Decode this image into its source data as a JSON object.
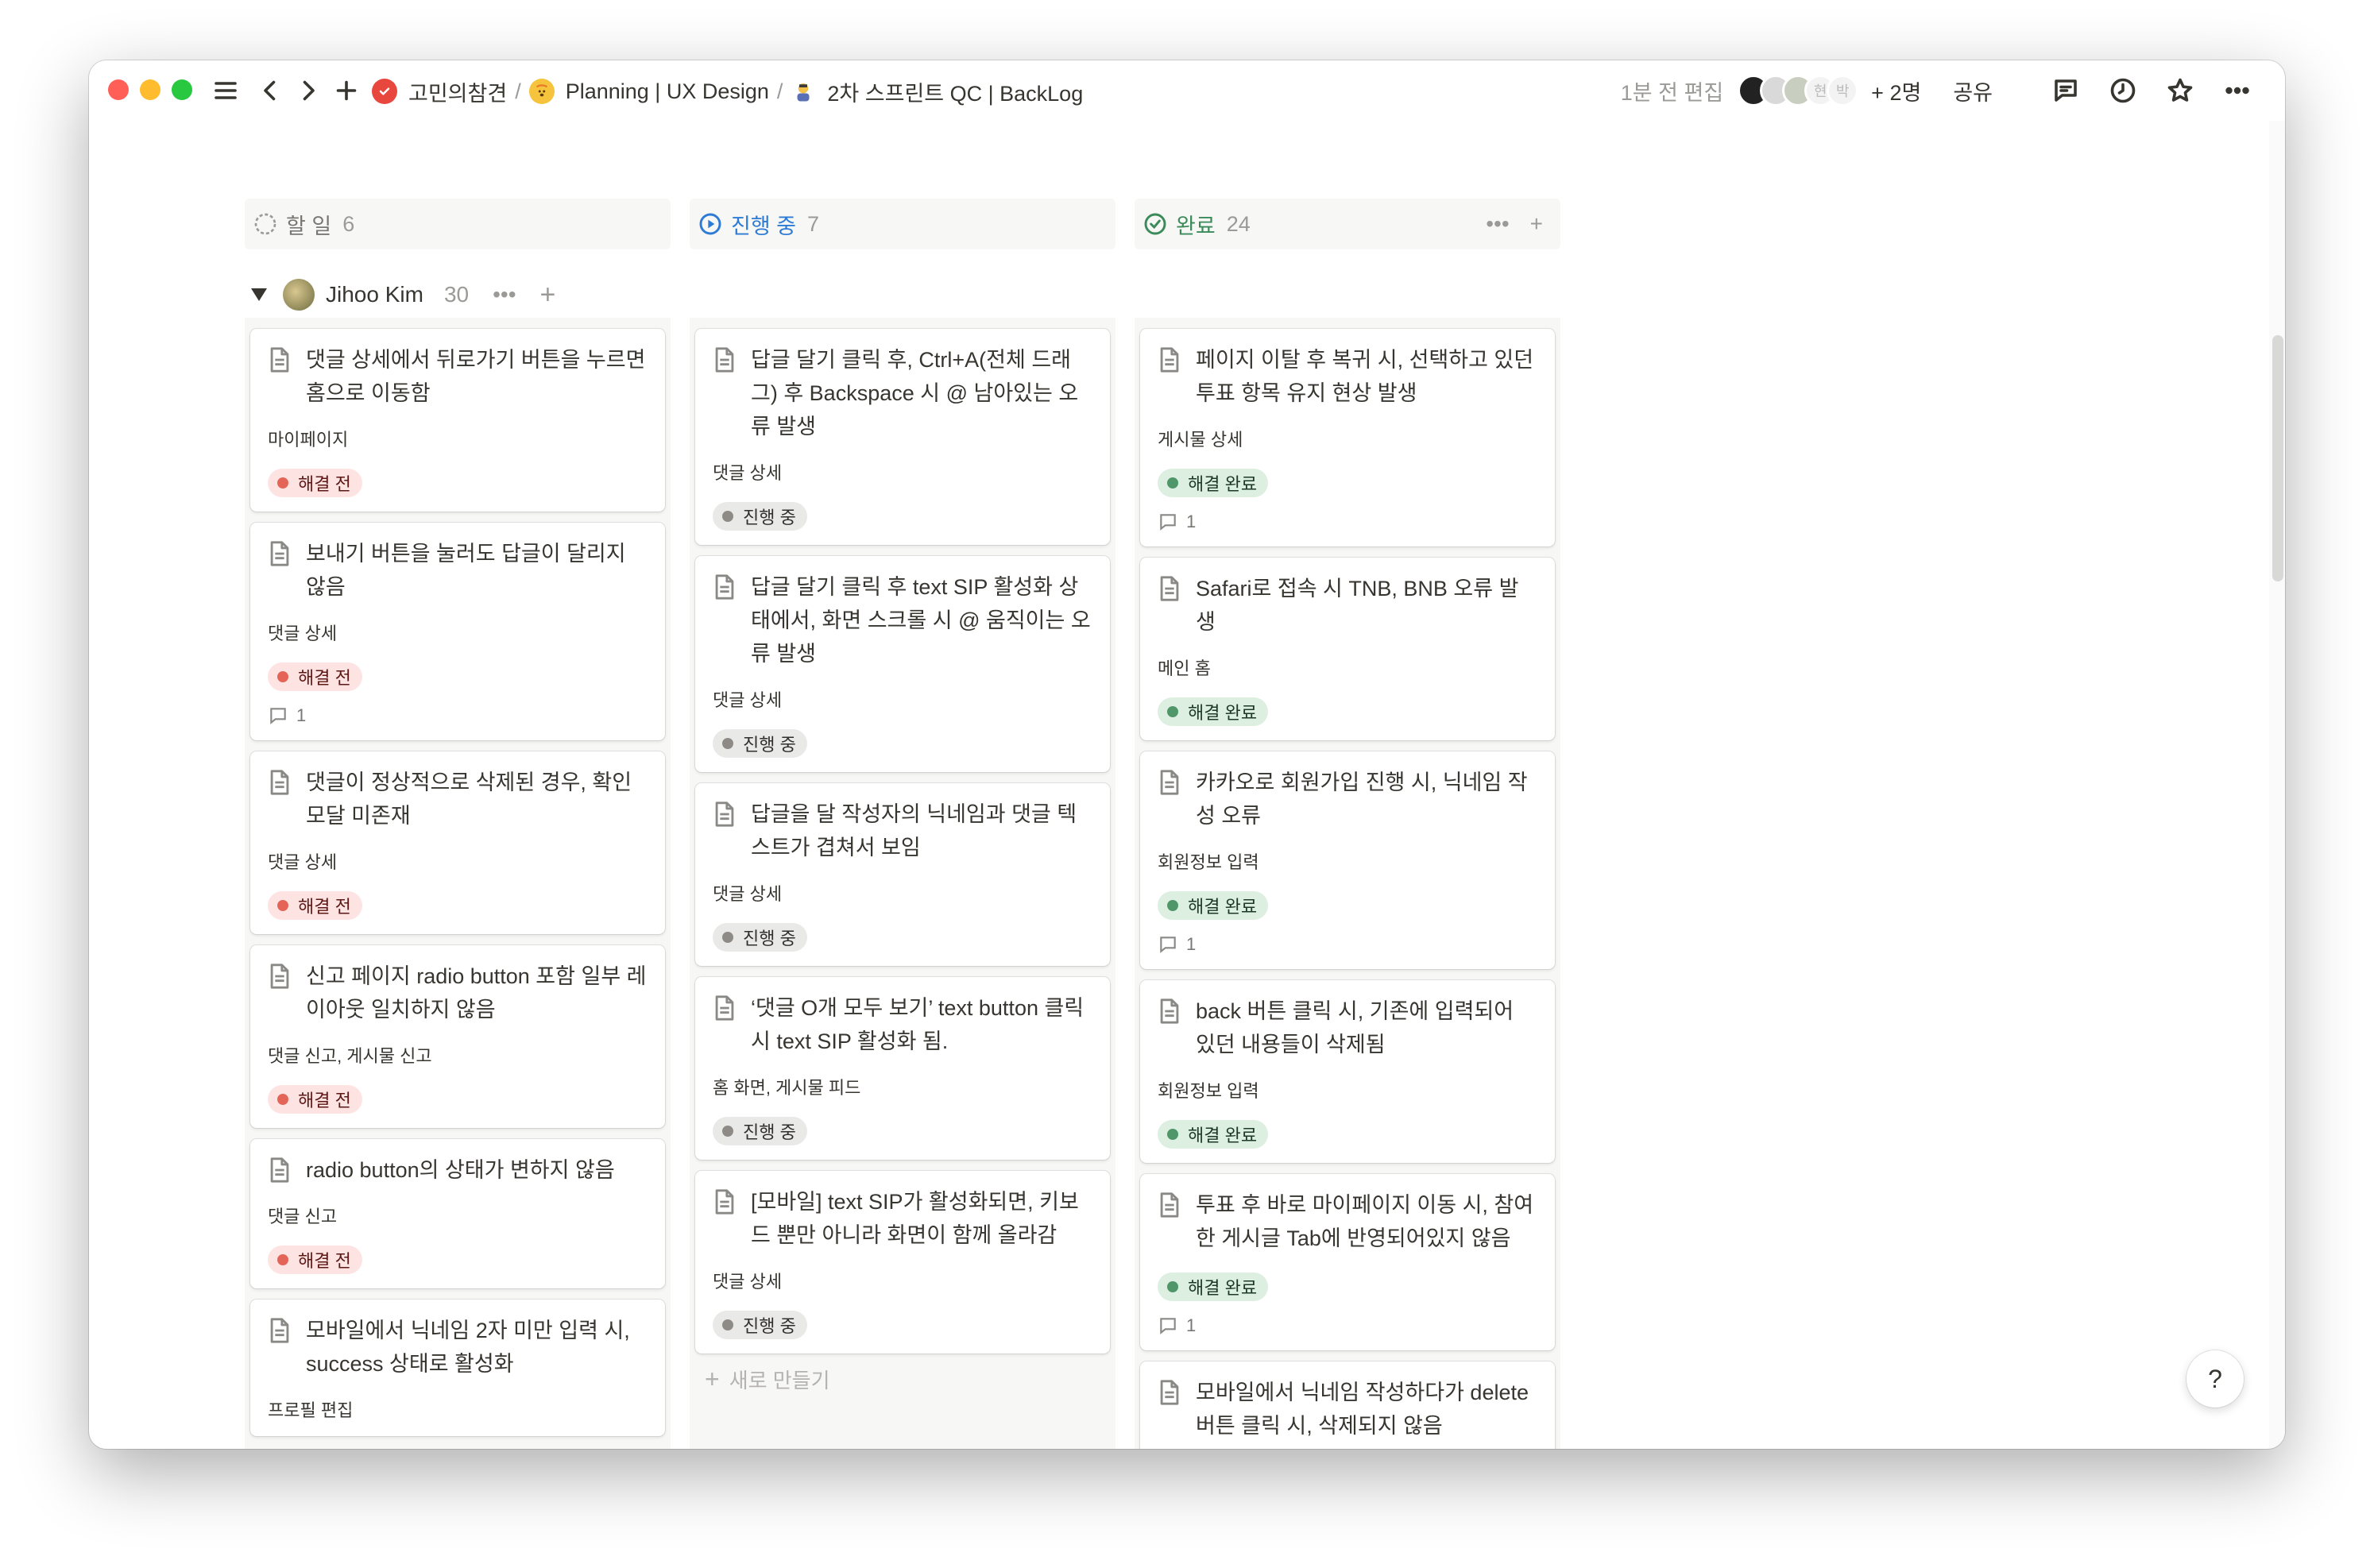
{
  "breadcrumb": [
    {
      "label": "고민의참견"
    },
    {
      "label": "Planning | UX Design"
    },
    {
      "label": "2차 스프린트 QC | BackLog"
    }
  ],
  "topbar": {
    "edited": "1분 전 편집",
    "avatar_initials": [
      "현",
      "박"
    ],
    "more_people": "+ 2명",
    "share": "공유"
  },
  "columns": [
    {
      "key": "todo",
      "label": "할 일",
      "count": "6"
    },
    {
      "key": "progress",
      "label": "진행 중",
      "count": "7"
    },
    {
      "key": "done",
      "label": "완료",
      "count": "24"
    }
  ],
  "group": {
    "name": "Jihoo Kim",
    "count": "30"
  },
  "cards_todo": [
    {
      "title": "댓글 상세에서 뒤로가기 버튼을 누르면 홈으로 이동함",
      "tag": "마이페이지",
      "status": "해결 전",
      "comments": ""
    },
    {
      "title": "보내기 버튼을 눌러도 답글이 달리지 않음",
      "tag": "댓글 상세",
      "status": "해결 전",
      "comments": "1"
    },
    {
      "title": "댓글이 정상적으로 삭제된 경우, 확인 모달 미존재",
      "tag": "댓글 상세",
      "status": "해결 전",
      "comments": ""
    },
    {
      "title": "신고 페이지 radio button 포함 일부 레이아웃 일치하지 않음",
      "tag": "댓글 신고, 게시물 신고",
      "status": "해결 전",
      "comments": ""
    },
    {
      "title": "radio button의 상태가 변하지 않음",
      "tag": "댓글 신고",
      "status": "해결 전",
      "comments": ""
    },
    {
      "title": "모바일에서 닉네임 2자 미만 입력 시, success 상태로 활성화",
      "tag": "프로필 편집",
      "status": "",
      "comments": ""
    }
  ],
  "cards_progress": [
    {
      "title": "답글 달기 클릭 후, Ctrl+A(전체 드래그) 후 Backspace 시 @ 남아있는 오류 발생",
      "tag": "댓글 상세",
      "status": "진행 중",
      "comments": ""
    },
    {
      "title": "답글 달기 클릭 후 text SIP 활성화 상태에서, 화면 스크롤 시 @ 움직이는 오류 발생",
      "tag": "댓글 상세",
      "status": "진행 중",
      "comments": ""
    },
    {
      "title": "답글을 달 작성자의 닉네임과 댓글 텍스트가 겹쳐서 보임",
      "tag": "댓글 상세",
      "status": "진행 중",
      "comments": ""
    },
    {
      "title": "‘댓글 O개 모두 보기’ text button 클릭 시 text SIP 활성화 됨.",
      "tag": "홈 화면, 게시물 피드",
      "status": "진행 중",
      "comments": ""
    },
    {
      "title": "[모바일] text SIP가 활성화되면, 키보드 뿐만 아니라 화면이 함께 올라감",
      "tag": "댓글 상세",
      "status": "진행 중",
      "comments": ""
    }
  ],
  "new_item": "새로 만들기",
  "cards_done": [
    {
      "title": "페이지 이탈 후 복귀 시, 선택하고 있던 투표 항목 유지 현상 발생",
      "tag": "게시물 상세",
      "status": "해결 완료",
      "comments": "1"
    },
    {
      "title": "Safari로 접속 시 TNB, BNB 오류 발생",
      "tag": "메인 홈",
      "status": "해결 완료",
      "comments": ""
    },
    {
      "title": "카카오로 회원가입 진행 시, 닉네임 작성 오류",
      "tag": "회원정보 입력",
      "status": "해결 완료",
      "comments": "1"
    },
    {
      "title": "back 버튼 클릭 시, 기존에 입력되어 있던 내용들이 삭제됨",
      "tag": "회원정보 입력",
      "status": "해결 완료",
      "comments": ""
    },
    {
      "title": "투표 후 바로 마이페이지 이동 시, 참여한 게시글 Tab에 반영되어있지 않음",
      "tag": "",
      "status": "해결 완료",
      "comments": "1"
    },
    {
      "title": "모바일에서 닉네임 작성하다가 delete 버튼 클릭 시, 삭제되지 않음",
      "tag": "",
      "status": "",
      "comments": ""
    }
  ],
  "help": "?",
  "colors": {
    "todo": "#e56458",
    "progress": "#2e7bd6",
    "done": "#4f9768"
  }
}
